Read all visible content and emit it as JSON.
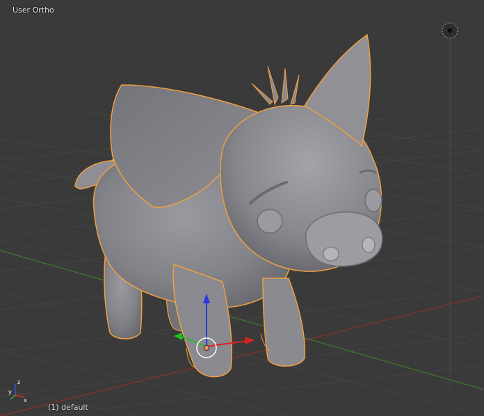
{
  "viewport": {
    "view_label": "User Ortho",
    "object_label": "(1) default",
    "background": "#3a3a3a",
    "grid_color": "#444444",
    "x_axis_color": "#8f2f2f",
    "y_axis_color": "#3f7a2f",
    "selection_outline": "#f0a040",
    "mesh_color": "#8c8c8c"
  },
  "gizmo": {
    "x_arrow_color": "#e02020",
    "y_arrow_color": "#20c020",
    "z_arrow_color": "#2a3ae0"
  },
  "mini_axes": {
    "x": "x",
    "y": "y",
    "z": "z"
  },
  "icons": {
    "view_widget": "view-navigation-icon",
    "origin": "object-origin-icon",
    "cursor_3d": "3d-cursor-icon"
  }
}
